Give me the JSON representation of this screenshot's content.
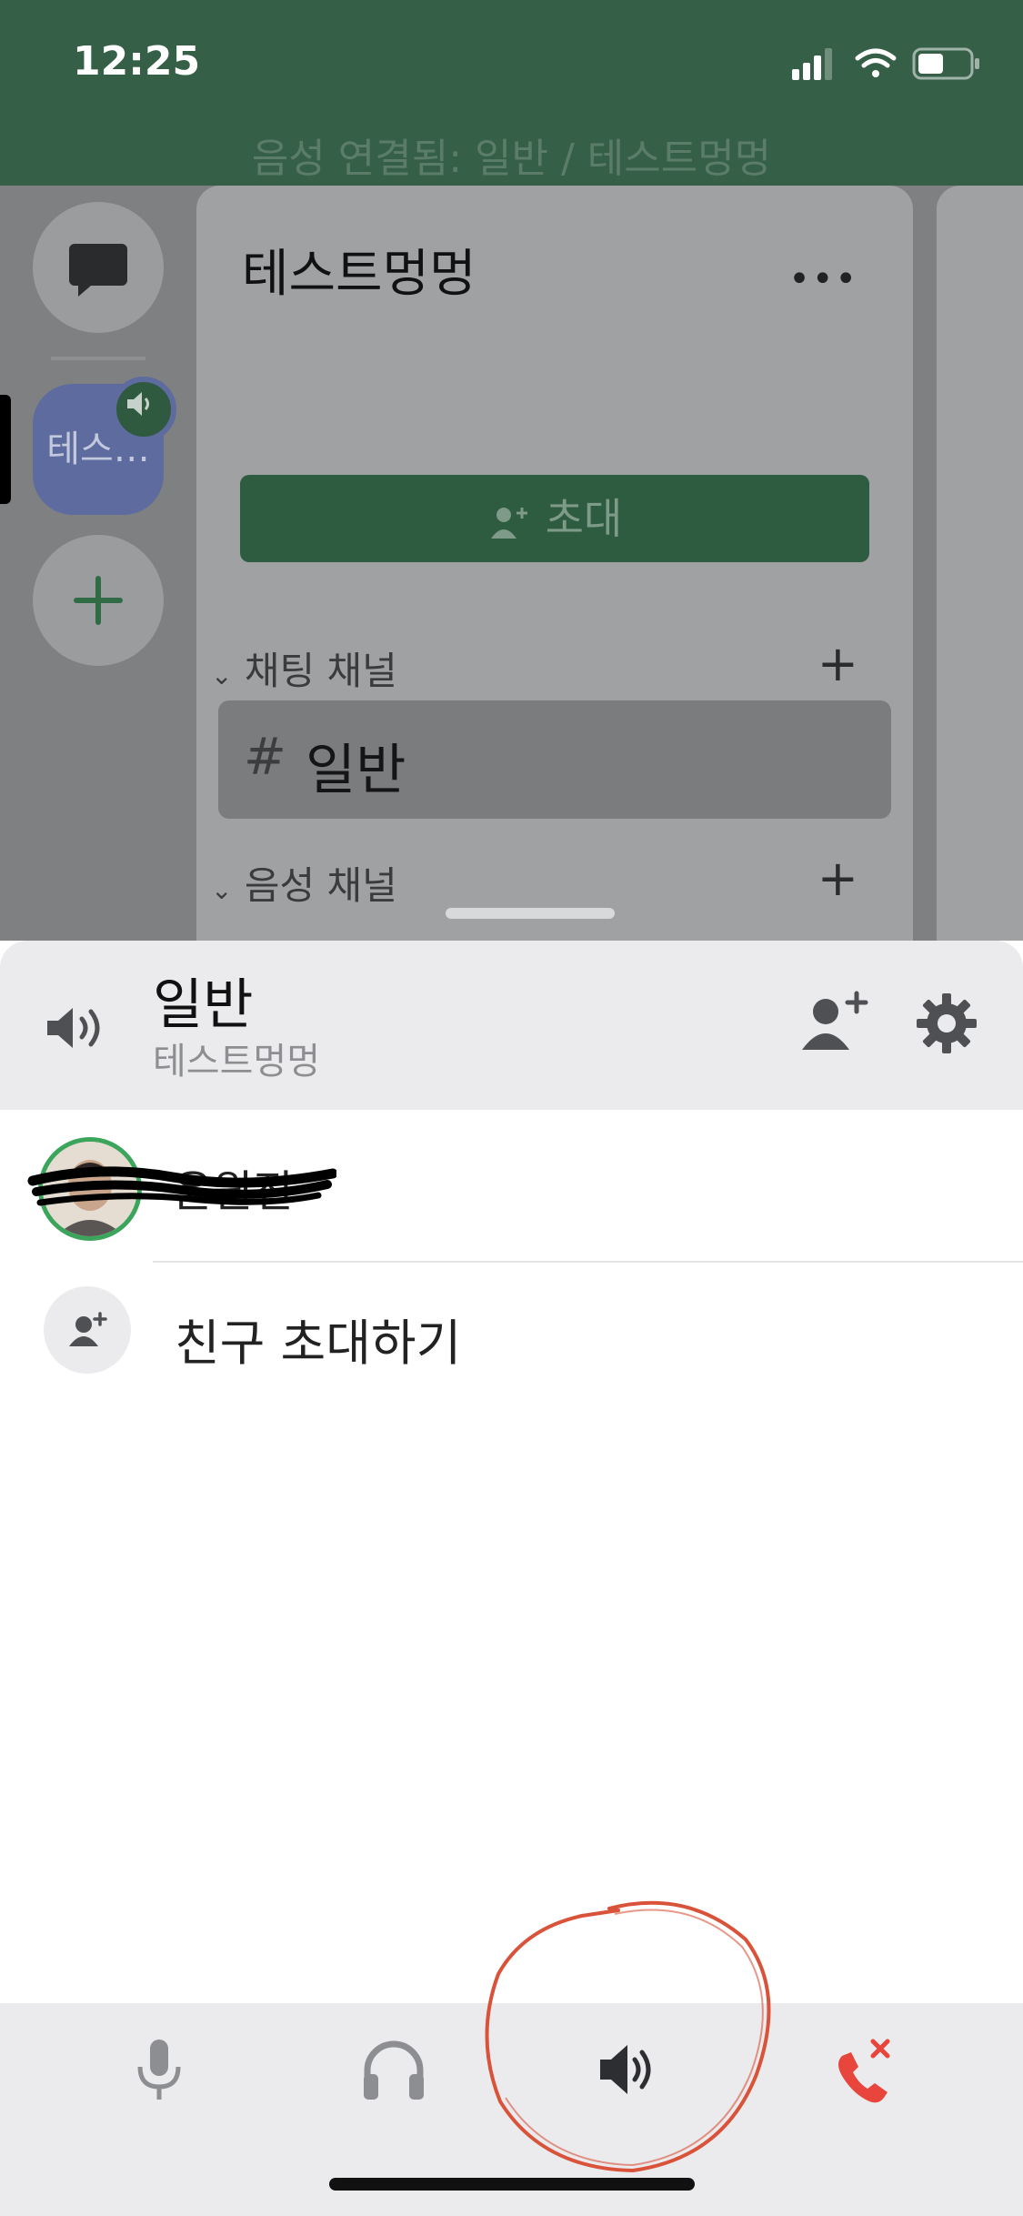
{
  "status_bar": {
    "time": "12:25"
  },
  "voice_banner": "음성 연결됨: 일반 / 테스트멍멍",
  "server_rail": {
    "server_abbrev": "테스…"
  },
  "channel_panel": {
    "server_name": "테스트멍멍",
    "invite_label": "초대",
    "chat_category": "채팅 채널",
    "voice_category": "음성 채널",
    "selected_channel": "일반",
    "hash": "#"
  },
  "voice_sheet": {
    "channel_name": "일반",
    "server_name": "테스트멍멍",
    "member_name": "윤원진",
    "invite_friends": "친구 초대하기"
  },
  "colors": {
    "top_green": "#355f47",
    "invite_green": "#2e5c40",
    "speaking_ring": "#3ba55c",
    "disconnect_red": "#e8453c",
    "annotation_red": "#d9533a"
  },
  "icons": {
    "controls": [
      "microphone-icon",
      "headphones-icon",
      "speaker-icon",
      "disconnect-call-icon"
    ]
  }
}
